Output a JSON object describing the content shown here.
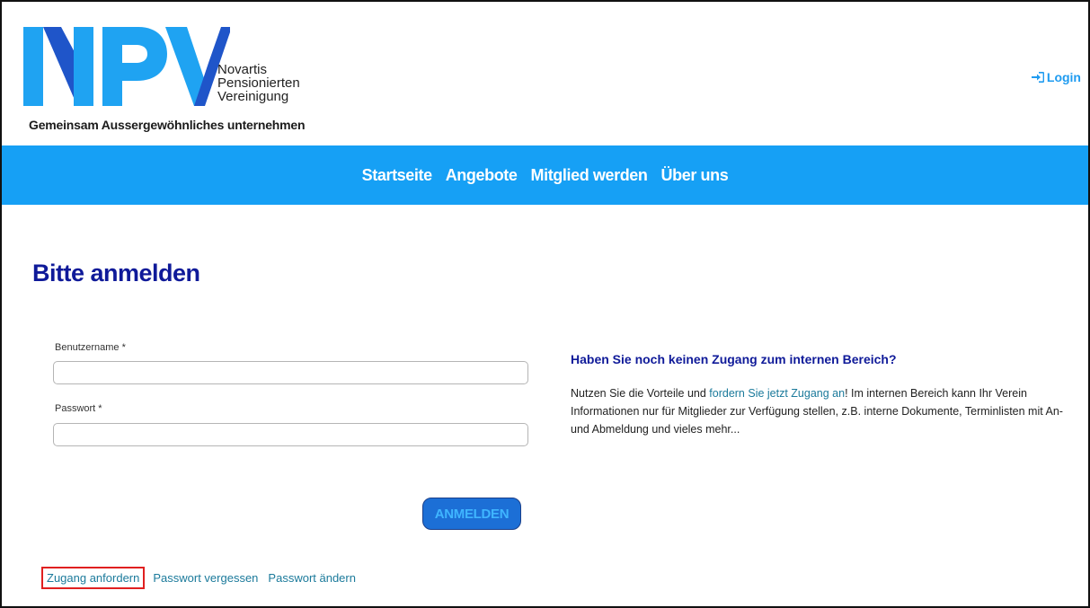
{
  "logo": {
    "letters": "NPV",
    "line1": "Novartis",
    "line2": "Pensionierten",
    "line3": "Vereinigung",
    "tagline": "Gemeinsam Aussergewöhnliches unternehmen"
  },
  "header": {
    "login_label": "Login"
  },
  "nav": {
    "items": [
      "Startseite",
      "Angebote",
      "Mitglied werden",
      "Über uns"
    ]
  },
  "main": {
    "title": "Bitte anmelden",
    "username_label": "Benutzername *",
    "username_value": "",
    "password_label": "Passwort *",
    "password_value": "",
    "submit_label": "ANMELDEN",
    "links": [
      "Zugang anfordern",
      "Passwort vergessen",
      "Passwort ändern"
    ]
  },
  "info": {
    "heading": "Haben Sie noch keinen Zugang zum internen Bereich?",
    "text_before": "Nutzen Sie die Vorteile und ",
    "link_text": "fordern Sie jetzt Zugang an",
    "text_after": "! Im internen Bereich kann Ihr Verein Informationen nur für Mitglieder zur Verfügung stellen, z.B. interne Dokumente, Terminlisten mit An- und Abmeldung und vieles mehr..."
  },
  "colors": {
    "brand_blue": "#16a0f5",
    "logo_light_blue": "#1fa3f2",
    "logo_dark_blue": "#1f55c9",
    "title_navy": "#0f1a99",
    "link_teal": "#1b7a9b",
    "highlight_red": "#e02020"
  }
}
